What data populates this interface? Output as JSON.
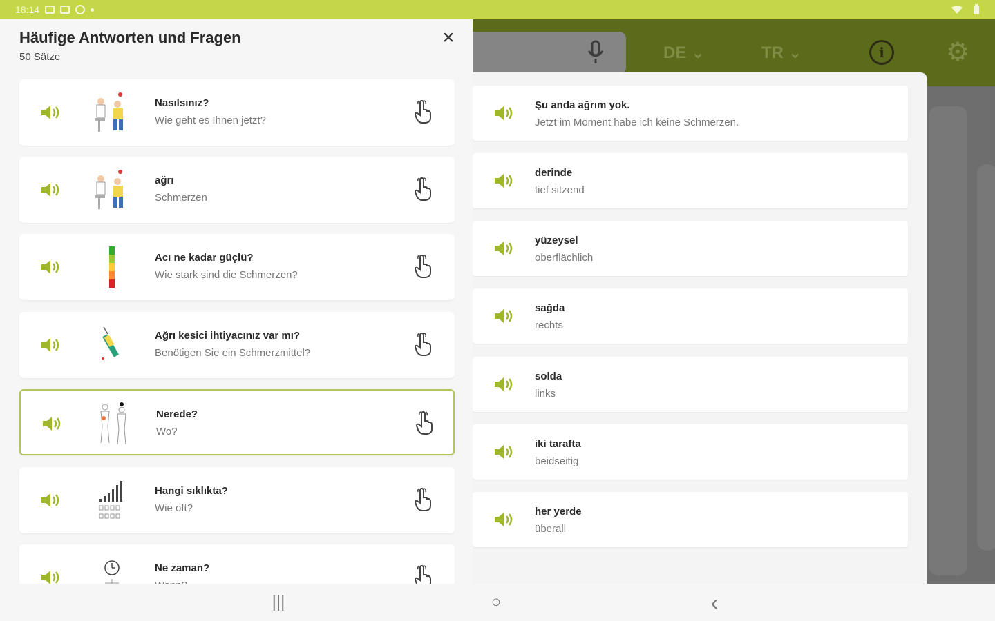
{
  "status_bar": {
    "time": "18:14"
  },
  "background": {
    "source_lang": "DE",
    "target_lang": "TR",
    "mic_icon": "microphone-icon",
    "info_icon": "info-icon",
    "settings_icon": "gear-icon"
  },
  "drawer": {
    "title": "Häufige Antworten und Fragen",
    "subtitle": "50 Sätze",
    "close_icon": "×",
    "items": [
      {
        "tr": "Nasılsınız?",
        "de": "Wie geht es Ihnen jetzt?",
        "thumb": "patient-doctor"
      },
      {
        "tr": "ağrı",
        "de": "Schmerzen",
        "thumb": "patient-doctor"
      },
      {
        "tr": "Acı ne kadar güçlü?",
        "de": "Wie stark sind die Schmerzen?",
        "thumb": "pain-scale"
      },
      {
        "tr": "Ağrı kesici ihtiyacınız var mı?",
        "de": "Benötigen Sie ein Schmerzmittel?",
        "thumb": "syringe"
      },
      {
        "tr": "Nerede?",
        "de": "Wo?",
        "thumb": "body-outline"
      },
      {
        "tr": "Hangi sıklıkta?",
        "de": "Wie oft?",
        "thumb": "frequency-chart"
      },
      {
        "tr": "Ne zaman?",
        "de": "Wann?",
        "thumb": "clock"
      }
    ]
  },
  "right_list": [
    {
      "tr": "Şu anda ağrım yok.",
      "de": "Jetzt im Moment habe ich keine Schmerzen."
    },
    {
      "tr": "derinde",
      "de": "tief sitzend"
    },
    {
      "tr": "yüzeysel",
      "de": "oberflächlich"
    },
    {
      "tr": "sağda",
      "de": "rechts"
    },
    {
      "tr": "solda",
      "de": "links"
    },
    {
      "tr": "iki tarafta",
      "de": "beidseitig"
    },
    {
      "tr": "her yerde",
      "de": "überall"
    }
  ],
  "nav": {
    "recents": "|||",
    "home": "○",
    "back": "‹"
  },
  "colors": {
    "accent": "#9fb82b",
    "status_bar": "#c5d648",
    "toolbar": "#5c6b1b",
    "selected_border": "#b6c55a"
  }
}
